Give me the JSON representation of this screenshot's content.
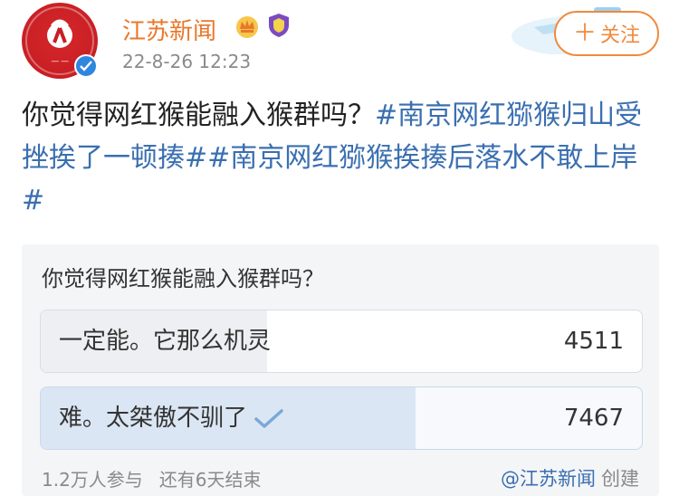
{
  "account": {
    "name": "江苏新闻",
    "time": "22-8-26 12:23",
    "follow_label": "关注"
  },
  "post": {
    "text_plain": "你觉得网红猴能融入猴群吗？",
    "hashtag1": "#南京网红猕猴归山受挫挨了一顿揍#",
    "hashtag2": "#南京网红猕猴挨揍后落水不敢上岸#"
  },
  "poll": {
    "question": "你觉得网红猴能融入猴群吗？",
    "options": [
      {
        "label": "一定能。它那么机灵",
        "count": "4511",
        "share": 0.377
      },
      {
        "label": "难。太桀傲不驯了",
        "count": "7467",
        "share": 0.623,
        "selected": true
      }
    ],
    "participants": "1.2万人参与",
    "time_left": "还有6天结束",
    "creator": "@江苏新闻",
    "created_label": "创建"
  },
  "colors": {
    "account_name": "#e8782b",
    "follow": "#f08a3c",
    "link": "#3a6fb0",
    "check": "#7aa7d8"
  },
  "icons": [
    "news-logo-icon",
    "verified-icon",
    "crown-badge-icon",
    "shield-badge-icon",
    "plus-icon",
    "check-icon"
  ]
}
